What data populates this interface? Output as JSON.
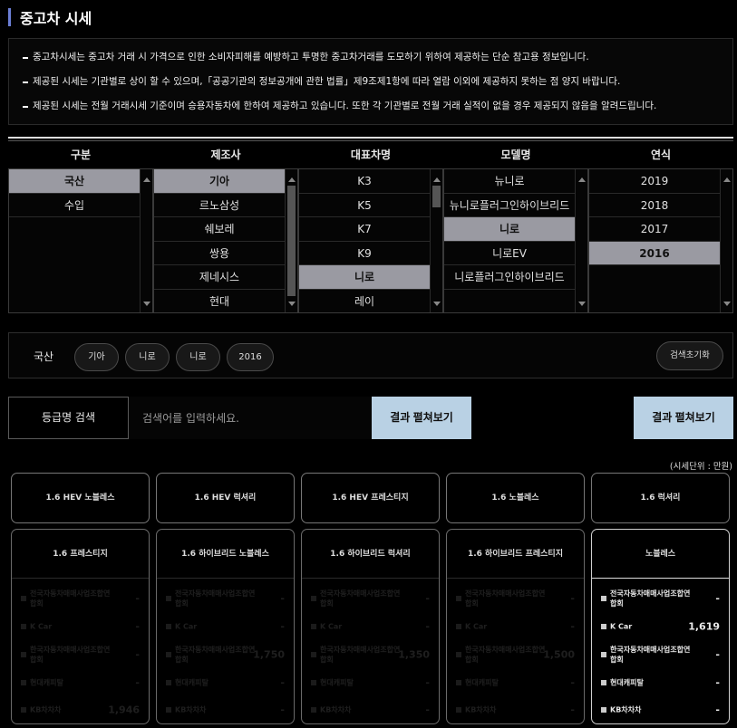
{
  "title": "중고차 시세",
  "notices": [
    "중고차시세는 중고차 거래 시 가격으로 인한 소비자피해를 예방하고 투명한 중고차거래를 도모하기 위하여 제공하는 단순 참고용 정보입니다.",
    "제공된 시세는 기관별로 상이 할 수 있으며,「공공기관의 정보공개에 관한 법률」제9조제1항에 따라 열람 이외에 제공하지 못하는 점 양지 바랍니다.",
    "제공된 시세는 전월 거래시세 기준이며 승용자동차에 한하여 제공하고 있습니다. 또한 각 기관별로 전월 거래 실적이 없을 경우 제공되지 않음을 알려드립니다."
  ],
  "selectors": [
    {
      "header": "구분",
      "items": [
        "국산",
        "수입"
      ],
      "selected": 0
    },
    {
      "header": "제조사",
      "items": [
        "기아",
        "르노삼성",
        "쉐보레",
        "쌍용",
        "제네시스",
        "현대"
      ],
      "selected": 0
    },
    {
      "header": "대표차명",
      "items": [
        "K3",
        "K5",
        "K7",
        "K9",
        "니로",
        "레이"
      ],
      "selected": 4
    },
    {
      "header": "모델명",
      "items": [
        "뉴니로",
        "뉴니로플러그인하이브리드",
        "니로",
        "니로EV",
        "니로플러그인하이브리드"
      ],
      "selected": 2
    },
    {
      "header": "연식",
      "items": [
        "2019",
        "2018",
        "2017",
        "2016"
      ],
      "selected": 3
    }
  ],
  "filter": {
    "label": "국산",
    "chips": [
      "기아",
      "니로",
      "니로",
      "2016"
    ],
    "reset": "검색초기화"
  },
  "search": {
    "label": "등급명 검색",
    "placeholder": "검색어를 입력하세요.",
    "button": "결과 펼쳐보기",
    "button2": "결과 펼쳐보기"
  },
  "unit": "(시세단위 : 만원)",
  "trims": [
    "1.6 HEV 노블레스",
    "1.6 HEV 럭셔리",
    "1.6 HEV 프레스티지",
    "1.6 노블레스",
    "1.6 럭셔리"
  ],
  "cards": [
    {
      "title": "1.6 프레스티지",
      "dim": true,
      "prices": [
        "-",
        "-",
        "-",
        "-",
        "1,946"
      ]
    },
    {
      "title": "1.6 하이브리드 노블레스",
      "dim": true,
      "prices": [
        "-",
        "-",
        "1,750",
        "-",
        "-"
      ]
    },
    {
      "title": "1.6 하이브리드 럭셔리",
      "dim": true,
      "prices": [
        "-",
        "-",
        "1,350",
        "-",
        "-"
      ]
    },
    {
      "title": "1.6 하이브리드 프레스티지",
      "dim": true,
      "prices": [
        "-",
        "-",
        "1,500",
        "-",
        "-"
      ]
    },
    {
      "title": "노블레스",
      "dim": false,
      "prices": [
        "-",
        "1,619",
        "-",
        "-",
        "-"
      ]
    }
  ],
  "sources": [
    "전국자동차매매사업조합연합회",
    "K Car",
    "한국자동차매매사업조합연합회",
    "현대캐피탈",
    "KB차차차"
  ],
  "sources_dim": [
    "전국자동차매매사업조합연합회",
    "K Car",
    "한국자동차매매사업조합연합회",
    "현대캐피탈",
    "KB차차차"
  ],
  "colors": {
    "selected": "#9a9aa2",
    "button": "#b9d1e4",
    "title_bar": "#6c7fd6"
  }
}
